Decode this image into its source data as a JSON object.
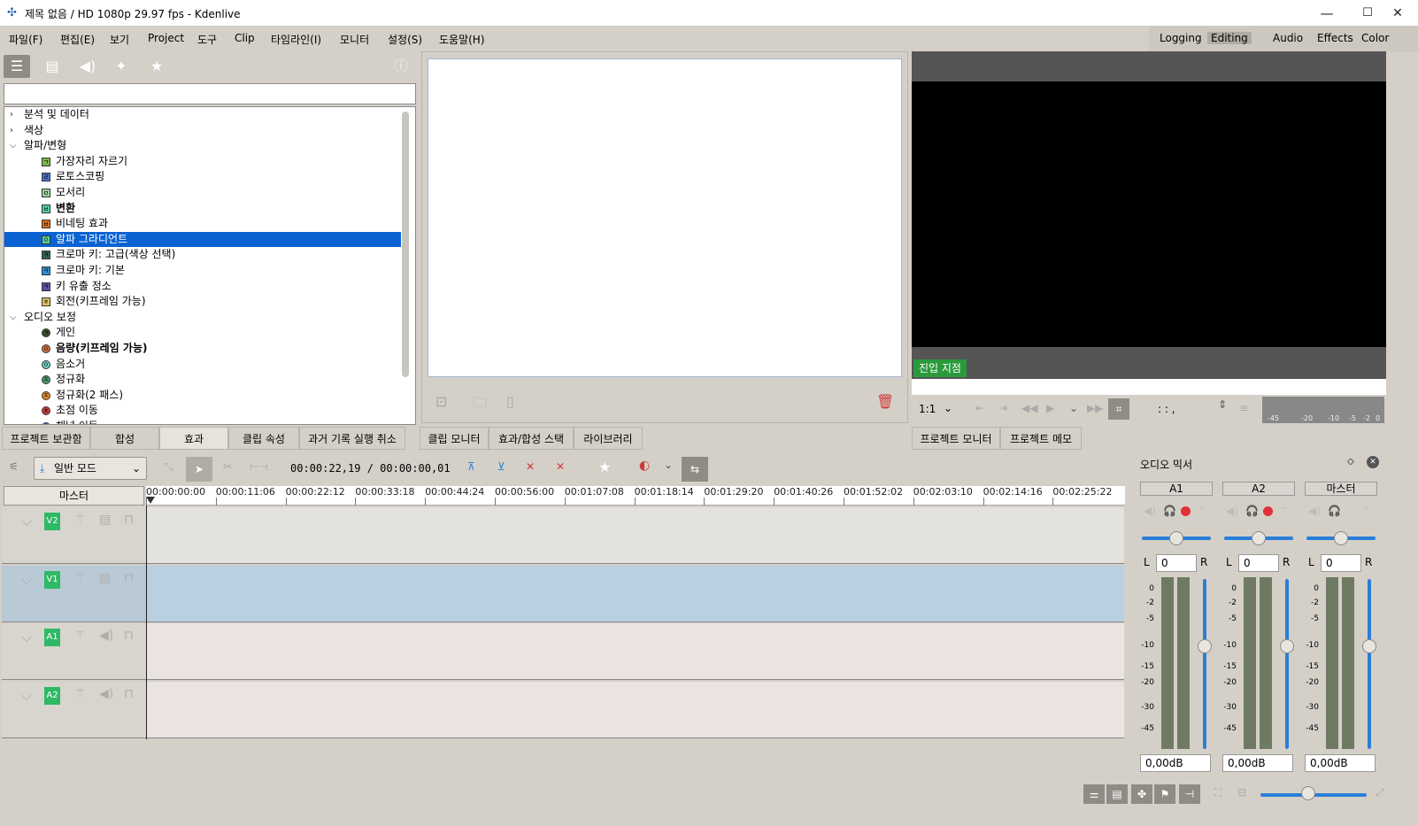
{
  "window": {
    "title": "제목 없음 / HD 1080p 29.97 fps - Kdenlive",
    "minimize": "—",
    "maximize": "☐",
    "close": "✕"
  },
  "menu": [
    "파일(F)",
    "편집(E)",
    "보기",
    "Project",
    "도구",
    "Clip",
    "타임라인(I)",
    "모니터",
    "설정(S)",
    "도움말(H)"
  ],
  "layouts": {
    "items": [
      "Logging",
      "Editing",
      "Audio",
      "Effects",
      "Color"
    ],
    "active": "Editing"
  },
  "effects": {
    "search_placeholder": "",
    "tree": [
      {
        "kind": "cat",
        "label": "분석 및 데이터",
        "expanded": false
      },
      {
        "kind": "cat",
        "label": "색상",
        "expanded": false
      },
      {
        "kind": "cat",
        "label": "알파/변형",
        "expanded": true
      },
      {
        "kind": "item",
        "label": "가장자리 자르기",
        "icon": "ㄱ",
        "color": "#7ab648",
        "bold": false
      },
      {
        "kind": "item",
        "label": "로토스코핑",
        "icon": "ㄹ",
        "color": "#4d6fd0",
        "bold": false
      },
      {
        "kind": "item",
        "label": "모서리",
        "icon": "ㅁ",
        "color": "#9ad39a",
        "bold": false
      },
      {
        "kind": "item",
        "label": "변환",
        "icon": "ㅂ",
        "color": "#4fd39a",
        "bold": true
      },
      {
        "kind": "item",
        "label": "비네팅 효과",
        "icon": "ㅂ",
        "color": "#d86f1e",
        "bold": false
      },
      {
        "kind": "item",
        "label": "알파 그라디언트",
        "icon": "ㅇ",
        "color": "#4fd39a",
        "bold": false,
        "selected": true
      },
      {
        "kind": "item",
        "label": "크로마 키: 고급(색상 선택)",
        "icon": "ㅋ",
        "color": "#2f5f5a",
        "bold": false
      },
      {
        "kind": "item",
        "label": "크로마 키: 기본",
        "icon": "ㅋ",
        "color": "#2a8fd0",
        "bold": false
      },
      {
        "kind": "item",
        "label": "키 유출 정소",
        "icon": "ㅋ",
        "color": "#5a4fa8",
        "bold": false
      },
      {
        "kind": "item",
        "label": "회전(키프레임 가능)",
        "icon": "ㅎ",
        "color": "#e0c060",
        "bold": false
      },
      {
        "kind": "cat",
        "label": "오디오 보정",
        "expanded": true
      },
      {
        "kind": "aitem",
        "label": "게인",
        "icon": "ㄱ",
        "color": "#3a4a2a",
        "bold": false
      },
      {
        "kind": "aitem",
        "label": "음량(키프레임 가능)",
        "icon": "ㅇ",
        "color": "#d07040",
        "bold": true
      },
      {
        "kind": "aitem",
        "label": "음소거",
        "icon": "ㅇ",
        "color": "#6fd0c8",
        "bold": false
      },
      {
        "kind": "aitem",
        "label": "정규화",
        "icon": "ㅈ",
        "color": "#4a9a6a",
        "bold": false
      },
      {
        "kind": "aitem",
        "label": "정규화(2 패스)",
        "icon": "ㅈ",
        "color": "#e08a2a",
        "bold": false
      },
      {
        "kind": "aitem",
        "label": "초점 이동",
        "icon": "ㅊ",
        "color": "#d03a3a",
        "bold": false
      },
      {
        "kind": "aitem",
        "label": "채널 이동",
        "icon": "ㅊ",
        "color": "#3a7ad0",
        "bold": false
      }
    ]
  },
  "left_tabs": [
    "프로젝트 보관함",
    "합성",
    "효과",
    "클립 속성",
    "과거 기록 실행 취소"
  ],
  "left_tabs_active": "효과",
  "center_tabs": [
    "클립 모니터",
    "효과/합성 스택",
    "라이브러리"
  ],
  "right_tabs": [
    "프로젝트 모니터",
    "프로젝트 메모"
  ],
  "project_monitor": {
    "inpoint_label": "진입 지점",
    "zoom": "1:1",
    "timecode": ": : ,"
  },
  "vu_mini_scale": [
    "-45",
    "-20",
    "-10",
    "-5",
    "-2",
    "0"
  ],
  "timeline": {
    "mode": "일반 모드",
    "timecode": "00:00:22,19 / 00:00:00,01",
    "master_label": "마스터",
    "ruler": [
      "00:00:00:00",
      "00:00:11:06",
      "00:00:22:12",
      "00:00:33:18",
      "00:00:44:24",
      "00:00:56:00",
      "00:01:07:08",
      "00:01:18:14",
      "00:01:29:20",
      "00:01:40:26",
      "00:01:52:02",
      "00:02:03:10",
      "00:02:14:16",
      "00:02:25:22"
    ],
    "tracks": [
      {
        "name": "V2",
        "type": "video",
        "selected": false
      },
      {
        "name": "V1",
        "type": "video",
        "selected": true
      },
      {
        "name": "A1",
        "type": "audio",
        "selected": false
      },
      {
        "name": "A2",
        "type": "audio",
        "selected": false
      }
    ]
  },
  "mixer": {
    "title": "오디오 믹서",
    "channels": [
      {
        "name": "A1",
        "pan": "0",
        "db": "0,00dB",
        "left": "L",
        "right": "R"
      },
      {
        "name": "A2",
        "pan": "0",
        "db": "0,00dB",
        "left": "L",
        "right": "R"
      },
      {
        "name": "마스터",
        "pan": "0",
        "db": "0,00dB",
        "left": "L",
        "right": "R"
      }
    ],
    "scale": [
      "0",
      "-2",
      "-5",
      "-10",
      "-15",
      "-20",
      "-30",
      "-45"
    ]
  },
  "colors": {
    "selection": "#0a63d2",
    "track_badge": "#2fb866",
    "inpoint": "#2a9a3c",
    "record": "#e0303a"
  }
}
